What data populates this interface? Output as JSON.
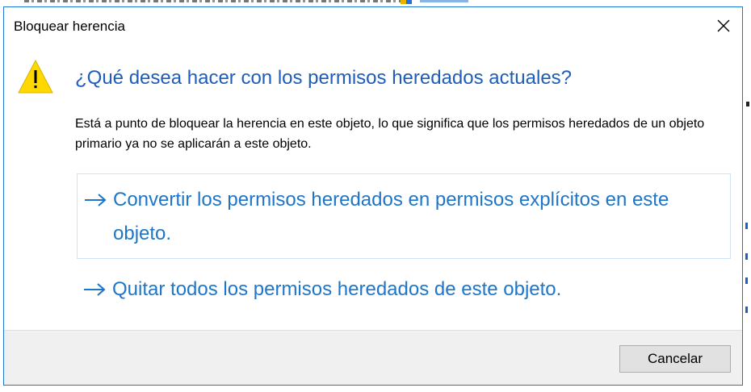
{
  "dialog": {
    "title": "Bloquear herencia",
    "main_instruction": "¿Qué desea hacer con los permisos heredados actuales?",
    "content": "Está a punto de bloquear la herencia en este objeto, lo que significa que los permisos heredados de un objeto primario ya no se aplicarán a este objeto.",
    "options": [
      {
        "label": "Convertir los permisos heredados en permisos explícitos en este objeto.",
        "icon": "arrow-right-icon"
      },
      {
        "label": "Quitar todos los permisos heredados de este objeto.",
        "icon": "arrow-right-icon"
      }
    ],
    "cancel_label": "Cancelar",
    "icons": {
      "close": "close-icon",
      "warning": "warning-icon"
    }
  },
  "colors": {
    "instruction": "#1f5db8",
    "link": "#1e76c9",
    "warning_fill": "#ffd800",
    "border": "#1c75d1"
  }
}
